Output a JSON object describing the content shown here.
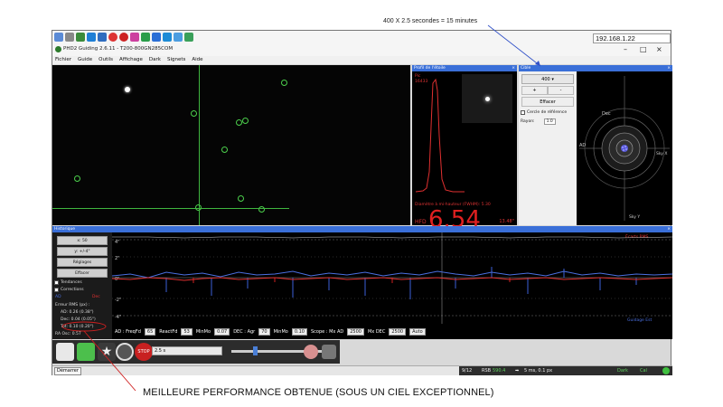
{
  "annotations": {
    "top_note": "400 X 2.5 secondes = 15 minutes",
    "bottom_note": "MEILLEURE PERFORMANCE OBTENUE (SOUS UN CIEL EXCEPTIONNEL)"
  },
  "window": {
    "title": "PHD2 Guiding 2.6.11 - T200-800GN285COM",
    "ip_address": "192.168.1.22",
    "minimize": "–",
    "maximize": "□",
    "close": "×"
  },
  "menu": [
    "Fichier",
    "Guide",
    "Outils",
    "Affichage",
    "Dark",
    "Signets",
    "Aide"
  ],
  "star_profile": {
    "title": "Profil de l'étoile",
    "top_line1": "Pic",
    "top_line2": "16433",
    "fwhm_label": "Diamètre à mi-hauteur (FWHM): 5.30",
    "hfd_label": "HFD",
    "hfd_value": "6.54",
    "hfd_px": "13.48\""
  },
  "target": {
    "title": "Cible",
    "scale_value": "400",
    "plus": "+",
    "minus": "-",
    "clear": "Effacer",
    "ref_circle": "Cercle de référence",
    "radius_label": "Rayon:",
    "radius_value": "1.0",
    "axis_dec": "Dec",
    "axis_ra": "AD",
    "axis_skyy": "Sky Y",
    "axis_skyx": "Sky X"
  },
  "history": {
    "title": "Historique",
    "x_scale": "x: 50",
    "y_scale": "y: +/-4\"",
    "settings": "Réglages",
    "clear": "Effacer",
    "trends": "Tendances",
    "corrections": "Corrections",
    "ad_label": "AD",
    "dec_label": "Dec",
    "rms_title": "Erreur RMS (px) :",
    "rms_ad": "AD: 0.26 (0.38\")",
    "rms_dec": "Dec: 0.04 (0.05\")",
    "rms_tot": "Tot: 0.10 (0.20\")",
    "ra_osc": "RA Osc: 0.57",
    "y_ticks": [
      "4\"",
      "2\"",
      "0\"",
      "-2\"",
      "-4\""
    ],
    "top_right_label": "Écarts RMS",
    "bottom_right_label": "Guidage Est",
    "params": {
      "ad_label": "AD : FreqFd",
      "ad_freq": "65",
      "react_label": "ReactFd",
      "react": "53",
      "minmo_label": "MinMo",
      "minmo": "0.07",
      "dec_label": "DEC : Agr",
      "dec_agr": "70",
      "dec_minmo_label": "MinMo",
      "dec_minmo": "0.10",
      "scope_label": "Scope : Mx AD",
      "max_ad": "2500",
      "max_dec_label": "Mx DEC",
      "max_dec": "2500",
      "mode": "Auto"
    }
  },
  "toolbar": {
    "exposure": "2.5 s"
  },
  "status": {
    "start": "Démarrer",
    "frames": "9/12",
    "snr_label": "RSB",
    "snr": "590.4",
    "guide_pulse": "5 ms, 0.1 px",
    "dark": "Dark",
    "cal": "Cal"
  },
  "colors": {
    "ra_line": "#4a6fe0",
    "dec_line": "#e03030",
    "accent": "#3a6fd8",
    "crosshair": "#3fb63f"
  }
}
